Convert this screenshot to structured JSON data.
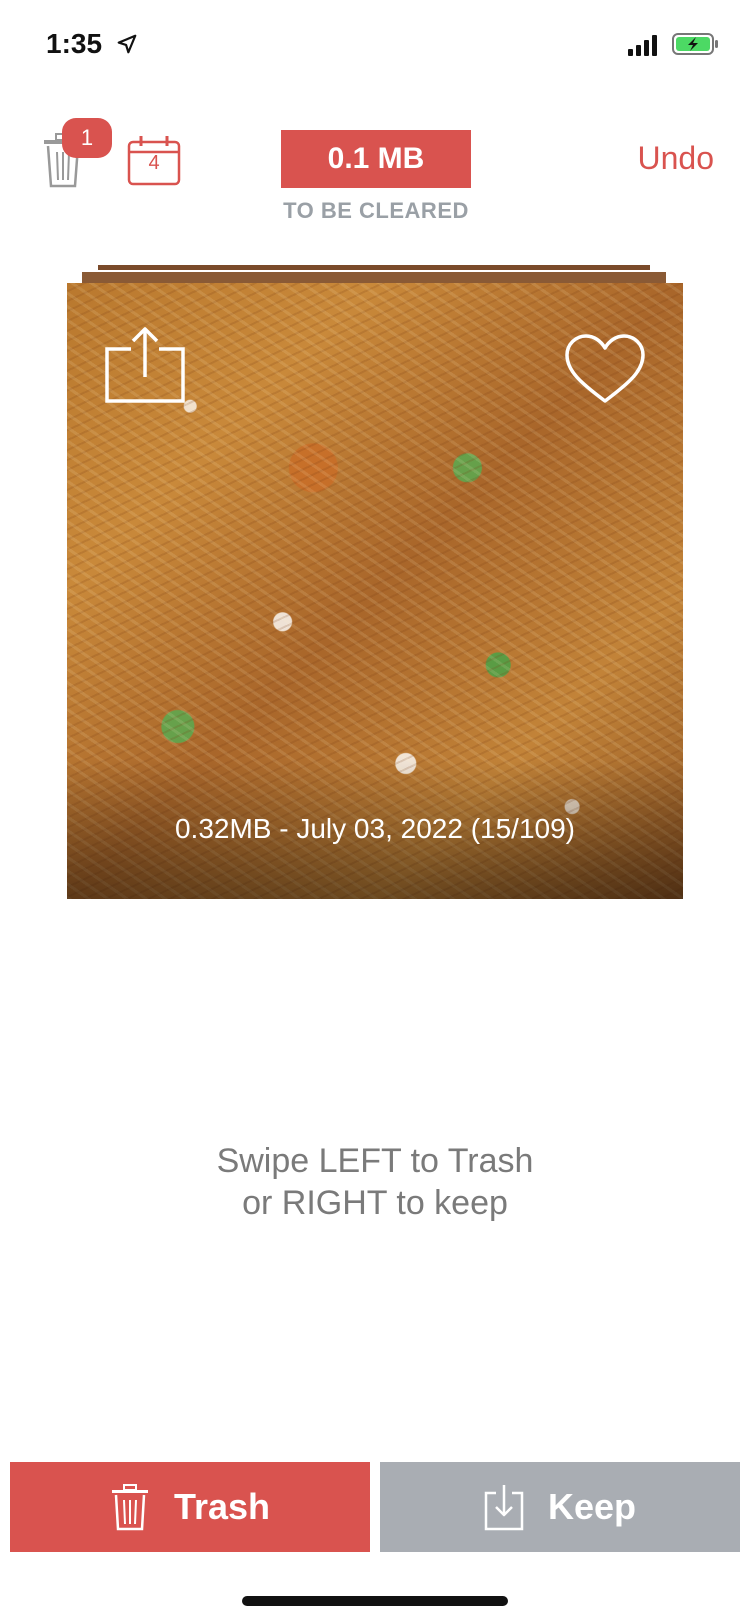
{
  "status_bar": {
    "time": "1:35",
    "location_icon": "location-arrow-icon",
    "signal_icon": "cellular-signal-icon",
    "battery_icon": "battery-charging-icon"
  },
  "header": {
    "trash_icon": "trash-icon",
    "trash_badge_count": "1",
    "calendar_icon": "calendar-icon",
    "calendar_day": "4",
    "size_value": "0.1 MB",
    "size_caption": "TO BE CLEARED",
    "undo_label": "Undo"
  },
  "photo": {
    "share_icon": "share-icon",
    "favorite_icon": "heart-icon",
    "info": "0.32MB - July 03, 2022 (15/109)"
  },
  "instructions": {
    "line1": "Swipe LEFT to Trash",
    "line2": "or RIGHT to keep"
  },
  "actions": {
    "trash_label": "Trash",
    "trash_icon": "trash-icon",
    "keep_label": "Keep",
    "keep_icon": "download-tray-icon"
  },
  "colors": {
    "accent": "#d9534f",
    "keep_gray": "#a9adb3",
    "caption_gray": "#9aa0a6",
    "instruction_gray": "#7a7a7a"
  }
}
